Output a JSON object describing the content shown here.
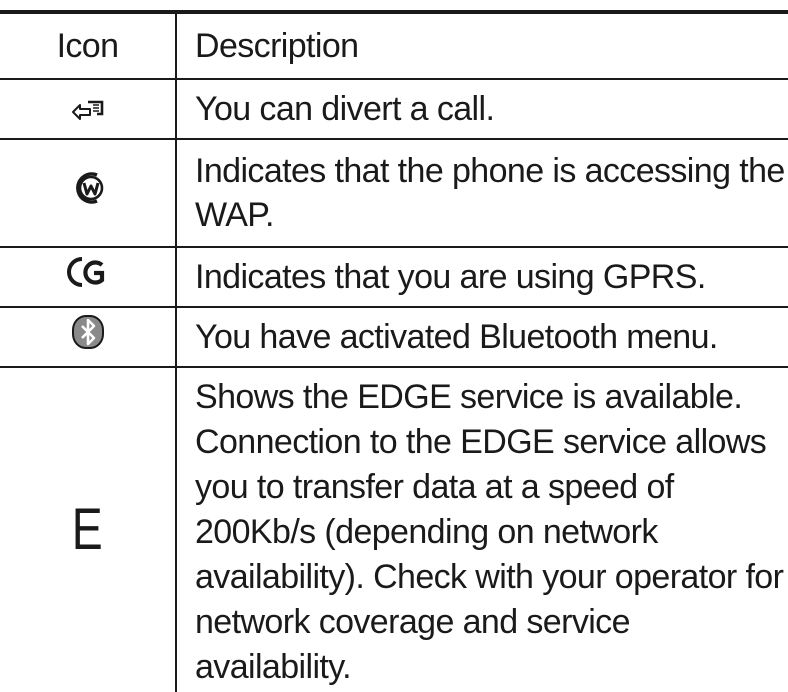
{
  "table": {
    "headers": {
      "icon": "Icon",
      "description": "Description"
    },
    "rows": [
      {
        "icon": "call-divert-icon",
        "description": "You can divert a call."
      },
      {
        "icon": "wap-icon",
        "description": "Indicates that the phone is accessing the WAP."
      },
      {
        "icon": "gprs-icon",
        "description": "Indicates that you are using GPRS."
      },
      {
        "icon": "bluetooth-icon",
        "description": "You have activated Bluetooth menu."
      },
      {
        "icon": "edge-icon",
        "icon_text": "E",
        "description": "Shows the EDGE service is available. Connection to the EDGE service allows you to transfer data at a speed of 200Kb/s (depending on  network availability). Check with your operator for network coverage and service availability."
      }
    ]
  },
  "colors": {
    "text": "#1a1a1a",
    "rule": "#1a1a1a",
    "background": "#ffffff"
  }
}
